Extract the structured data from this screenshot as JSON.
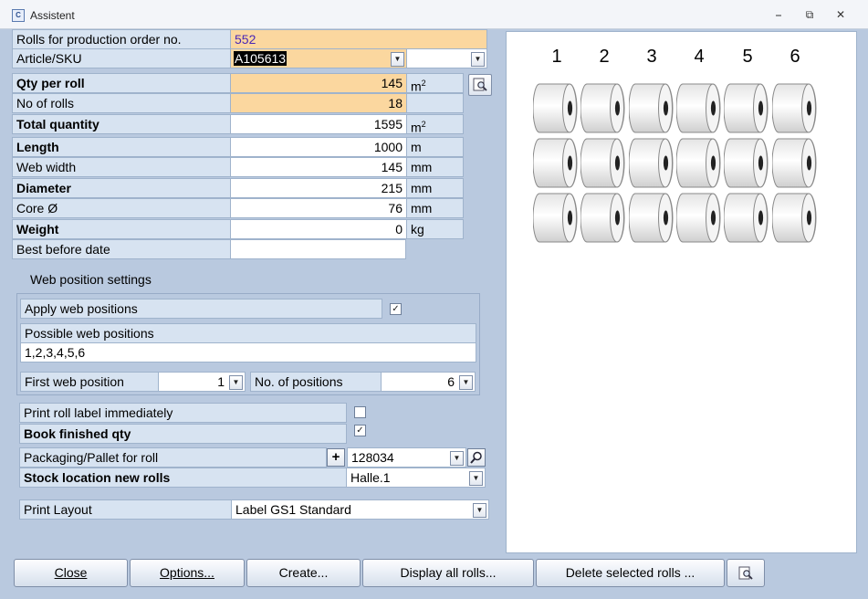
{
  "window": {
    "title": "Assistent",
    "icon_name": "app-logo-icon",
    "controls": [
      "minimize-icon",
      "restore-icon",
      "close-icon"
    ]
  },
  "form": {
    "production_order": {
      "label": "Rolls for production order no.",
      "value": "552"
    },
    "article": {
      "label": "Article/SKU",
      "value": "A105613",
      "second_value": ""
    },
    "qty_per_roll": {
      "label": "Qty per roll",
      "value": "145",
      "unit": "m"
    },
    "no_of_rolls": {
      "label": "No of rolls",
      "value": "18"
    },
    "total_quantity": {
      "label": "Total quantity",
      "value": "1595",
      "unit": "m"
    },
    "length": {
      "label": "Length",
      "value": "1000",
      "unit": "m"
    },
    "web_width": {
      "label": "Web width",
      "value": "145",
      "unit": "mm"
    },
    "diameter": {
      "label": "Diameter",
      "value": "215",
      "unit": "mm"
    },
    "core": {
      "label": "Core Ø",
      "value": "76",
      "unit": "mm"
    },
    "weight": {
      "label": "Weight",
      "value": "0",
      "unit": "kg"
    },
    "best_before": {
      "label": "Best before date",
      "value": ""
    },
    "unit_superscript": "2"
  },
  "web_position": {
    "section_title": "Web position settings",
    "apply_label": "Apply web positions",
    "apply_checked": true,
    "possible_label": "Possible web positions",
    "possible_value": "1,2,3,4,5,6",
    "first_label": "First web position",
    "first_value": "1",
    "count_label": "No. of positions",
    "count_value": "6"
  },
  "options": {
    "print_label": "Print roll label immediately",
    "print_checked": false,
    "book_label": "Book finished qty",
    "book_checked": true,
    "packaging_label": "Packaging/Pallet for roll",
    "packaging_value": "128034",
    "stock_label": "Stock location new rolls",
    "stock_value": "Halle.1",
    "layout_label": "Print Layout",
    "layout_value": "Label GS1 Standard"
  },
  "preview": {
    "columns": [
      "1",
      "2",
      "3",
      "4",
      "5",
      "6"
    ],
    "rows": 3
  },
  "footer": {
    "close": "Close",
    "options": "Options...",
    "create": "Create...",
    "display_all": "Display all rolls...",
    "delete_selected": "Delete selected rolls ..."
  },
  "colors": {
    "highlight": "#fbd79f",
    "label_bg": "#d7e3f1",
    "window_bg": "#b9c9df",
    "order_number": "#4a27b5"
  }
}
